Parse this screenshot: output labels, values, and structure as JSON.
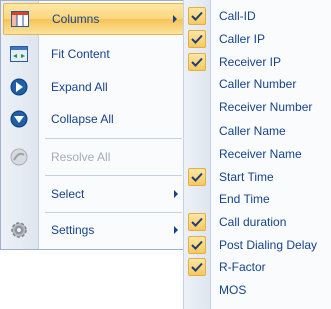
{
  "menu": {
    "items": [
      {
        "label": "Columns",
        "icon": "columns-icon",
        "has_submenu": true,
        "highlighted": true,
        "enabled": true
      },
      {
        "label": "Fit Content",
        "icon": "fit-content-icon",
        "enabled": true
      },
      {
        "label": "Expand All",
        "icon": "expand-all-icon",
        "enabled": true
      },
      {
        "label": "Collapse All",
        "icon": "collapse-all-icon",
        "enabled": true
      },
      {
        "label": "Resolve All",
        "icon": "resolve-all-icon",
        "enabled": false
      },
      {
        "label": "Select",
        "has_submenu": true,
        "enabled": true
      },
      {
        "label": "Settings",
        "icon": "gear-icon",
        "has_submenu": true,
        "enabled": true
      }
    ]
  },
  "columns_submenu": {
    "items": [
      {
        "label": "Call-ID",
        "checked": true
      },
      {
        "label": "Caller IP",
        "checked": true
      },
      {
        "label": "Receiver IP",
        "checked": true
      },
      {
        "label": "Caller Number",
        "checked": false
      },
      {
        "label": "Receiver Number",
        "checked": false
      },
      {
        "label": "Caller Name",
        "checked": false
      },
      {
        "label": "Receiver Name",
        "checked": false
      },
      {
        "label": "Start Time",
        "checked": true
      },
      {
        "label": "End Time",
        "checked": false
      },
      {
        "label": "Call duration",
        "checked": true
      },
      {
        "label": "Post Dialing Delay",
        "checked": true
      },
      {
        "label": "R-Factor",
        "checked": true
      },
      {
        "label": "MOS",
        "checked": false
      }
    ]
  },
  "colors": {
    "text": "#15428b",
    "disabled_text": "#a5acb5",
    "highlight": "#fbd67c",
    "check": "#1c3f7a"
  }
}
